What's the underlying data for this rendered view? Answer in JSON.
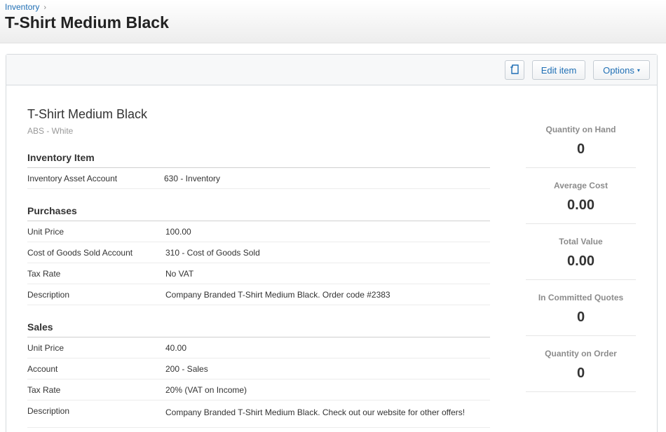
{
  "breadcrumb": {
    "parent": "Inventory",
    "separator": "›"
  },
  "page": {
    "title": "T-Shirt Medium Black"
  },
  "toolbar": {
    "copy_icon": "copy-icon",
    "edit_label": "Edit item",
    "options_label": "Options",
    "options_caret": "▾"
  },
  "item": {
    "name": "T-Shirt Medium Black",
    "code": "ABS - White"
  },
  "sections": {
    "inventory": {
      "title": "Inventory Item",
      "rows": [
        {
          "label": "Inventory Asset Account",
          "value": "630 - Inventory"
        }
      ]
    },
    "purchases": {
      "title": "Purchases",
      "rows": [
        {
          "label": "Unit Price",
          "value": "100.00"
        },
        {
          "label": "Cost of Goods Sold Account",
          "value": "310 - Cost of Goods Sold"
        },
        {
          "label": "Tax Rate",
          "value": "No VAT"
        },
        {
          "label": "Description",
          "value": "Company Branded T-Shirt Medium Black. Order code #2383"
        }
      ]
    },
    "sales": {
      "title": "Sales",
      "rows": [
        {
          "label": "Unit Price",
          "value": "40.00"
        },
        {
          "label": "Account",
          "value": "200 - Sales"
        },
        {
          "label": "Tax Rate",
          "value": "20% (VAT on Income)"
        },
        {
          "label": "Description",
          "value": "Company Branded T-Shirt Medium Black. Check out our website for other offers!"
        }
      ]
    }
  },
  "stats": [
    {
      "label": "Quantity on Hand",
      "value": "0"
    },
    {
      "label": "Average Cost",
      "value": "0.00"
    },
    {
      "label": "Total Value",
      "value": "0.00"
    },
    {
      "label": "In Committed Quotes",
      "value": "0"
    },
    {
      "label": "Quantity on Order",
      "value": "0"
    }
  ],
  "colors": {
    "link": "#1f6fb5",
    "muted": "#999999",
    "border": "#d6dadd"
  }
}
